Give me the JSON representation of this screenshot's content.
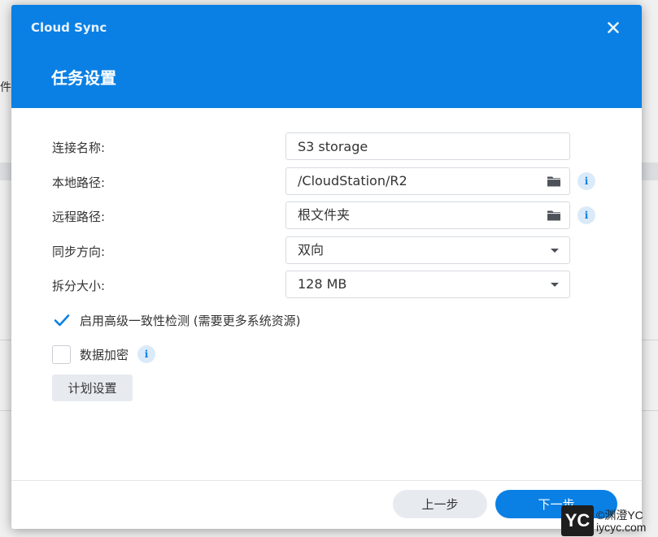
{
  "background": {
    "partial_text": "件"
  },
  "dialog": {
    "app_name": "Cloud Sync",
    "title": "任务设置",
    "close_icon": "close-icon",
    "fields": {
      "connection_name": {
        "label": "连接名称:",
        "value": "S3 storage"
      },
      "local_path": {
        "label": "本地路径:",
        "value": "/CloudStation/R2",
        "icon": "folder-icon",
        "info_icon": "info-icon"
      },
      "remote_path": {
        "label": "远程路径:",
        "value": "根文件夹",
        "icon": "folder-icon",
        "info_icon": "info-icon"
      },
      "sync_direction": {
        "label": "同步方向:",
        "value": "双向"
      },
      "split_size": {
        "label": "拆分大小:",
        "value": "128 MB"
      }
    },
    "options": {
      "advanced_consistency": {
        "label": "启用高级一致性检测 (需要更多系统资源)",
        "checked": true
      },
      "data_encryption": {
        "label": "数据加密",
        "checked": false,
        "info_icon": "info-icon"
      }
    },
    "schedule_button": "计划设置",
    "footer": {
      "prev_button": "上一步",
      "next_button": "下一步"
    }
  },
  "watermark": {
    "badge": "YC",
    "line1": "©渊澄YC",
    "line2": "iycyc.com"
  },
  "colors": {
    "accent": "#0a80e4",
    "button_secondary": "#e7ebf0"
  }
}
